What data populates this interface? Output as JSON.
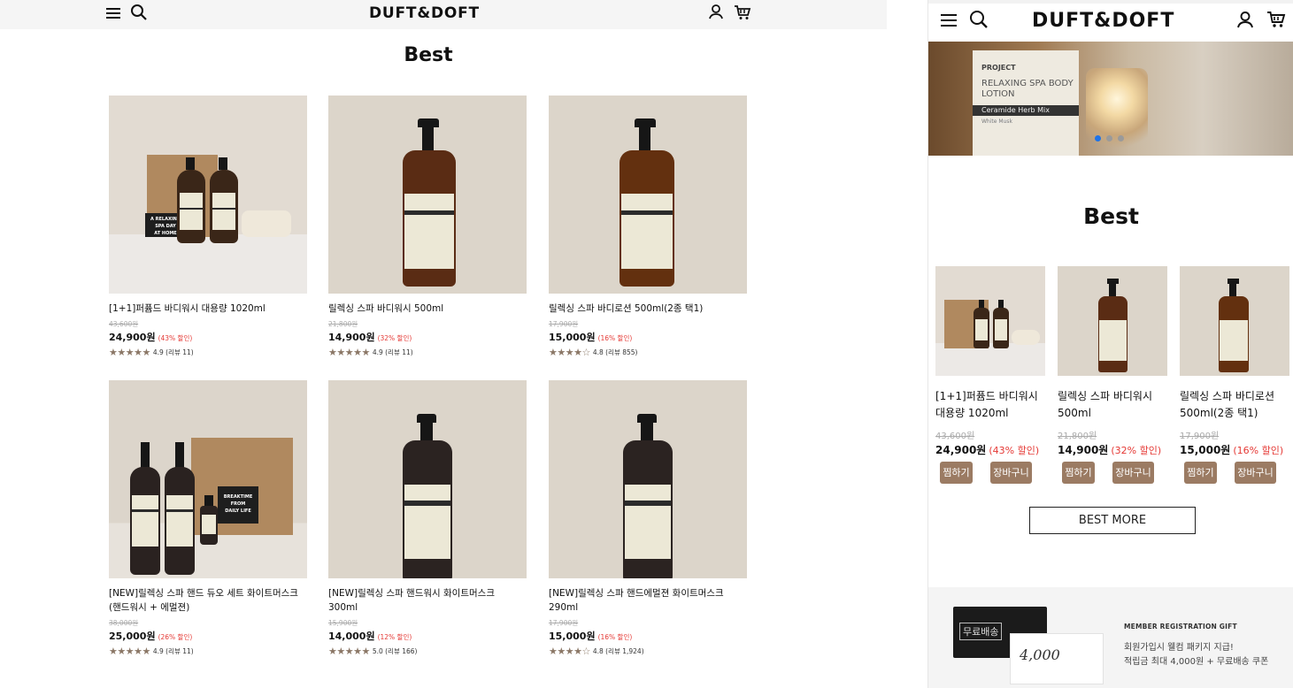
{
  "brand": "DUFT&DOFT",
  "section_title": "Best",
  "desktop_products": [
    {
      "name": "[1+1]퍼퓸드 바디워시 대용량 1020ml",
      "original_price": "43,600원",
      "price": "24,900원",
      "discount": "(43% 할인)",
      "stars": "★★★★★",
      "rating": "4.9 (리뷰 11)"
    },
    {
      "name": "릴렉싱 스파 바디워시 500ml",
      "original_price": "21,800원",
      "price": "14,900원",
      "discount": "(32% 할인)",
      "stars": "★★★★★",
      "rating": "4.9 (리뷰 11)"
    },
    {
      "name": "릴렉싱 스파 바디로션 500ml(2종 택1)",
      "original_price": "17,900원",
      "price": "15,000원",
      "discount": "(16% 할인)",
      "stars": "★★★★☆",
      "rating": "4.8 (리뷰 855)"
    },
    {
      "name": "[NEW]릴렉싱 스파 핸드 듀오 세트 화이트머스크(핸드워시 + 에멀젼)",
      "original_price": "38,000원",
      "price": "25,000원",
      "discount": "(26% 할인)",
      "stars": "★★★★★",
      "rating": "4.9 (리뷰 11)"
    },
    {
      "name": "[NEW]릴렉싱 스파 핸드워시 화이트머스크 300ml",
      "original_price": "15,900원",
      "price": "14,000원",
      "discount": "(12% 할인)",
      "stars": "★★★★★",
      "rating": "5.0 (리뷰 166)"
    },
    {
      "name": "[NEW]릴렉싱 스파 핸드에멀젼 화이트머스크 290ml",
      "original_price": "17,900원",
      "price": "15,000원",
      "discount": "(16% 할인)",
      "stars": "★★★★☆",
      "rating": "4.8 (리뷰 1,924)"
    }
  ],
  "mobile_products": [
    {
      "name": "[1+1]퍼퓸드 바디워시 대용량 1020ml",
      "original_price": "43,600원",
      "price": "24,900원",
      "discount": "(43% 할인)"
    },
    {
      "name": "릴렉싱 스파 바디워시 500ml",
      "original_price": "21,800원",
      "price": "14,900원",
      "discount": "(32% 할인)"
    },
    {
      "name": "릴렉싱 스파 바디로션 500ml(2종 택1)",
      "original_price": "17,900원",
      "price": "15,000원",
      "discount": "(16% 할인)"
    }
  ],
  "mobile_buttons": {
    "wishlist": "찜하기",
    "cart": "장바구니"
  },
  "best_more": "BEST MORE",
  "hero": {
    "label_brand": "PROJECT",
    "label_title": "RELAXING SPA BODY LOTION",
    "label_band": "Ceramide Herb Mix Complex",
    "label_scent": "White Musk",
    "active_slide": 1,
    "slide_count": 3
  },
  "gift": {
    "heading": "MEMBER REGISTRATION GIFT",
    "line1": "회원가입시 웰컴 패키지 지급!",
    "line2": "적립금 최대 4,000원 + 무료배송 쿠폰",
    "card_free_shipping": "무료배송",
    "card_amount": "4,000"
  },
  "colors": {
    "accent_brown": "#9b7b63",
    "discount_red": "#e53935",
    "star_brown": "#8b7766",
    "carousel_active": "#1e73e8"
  },
  "icons": [
    "menu-icon",
    "search-icon",
    "user-icon",
    "cart-icon"
  ]
}
